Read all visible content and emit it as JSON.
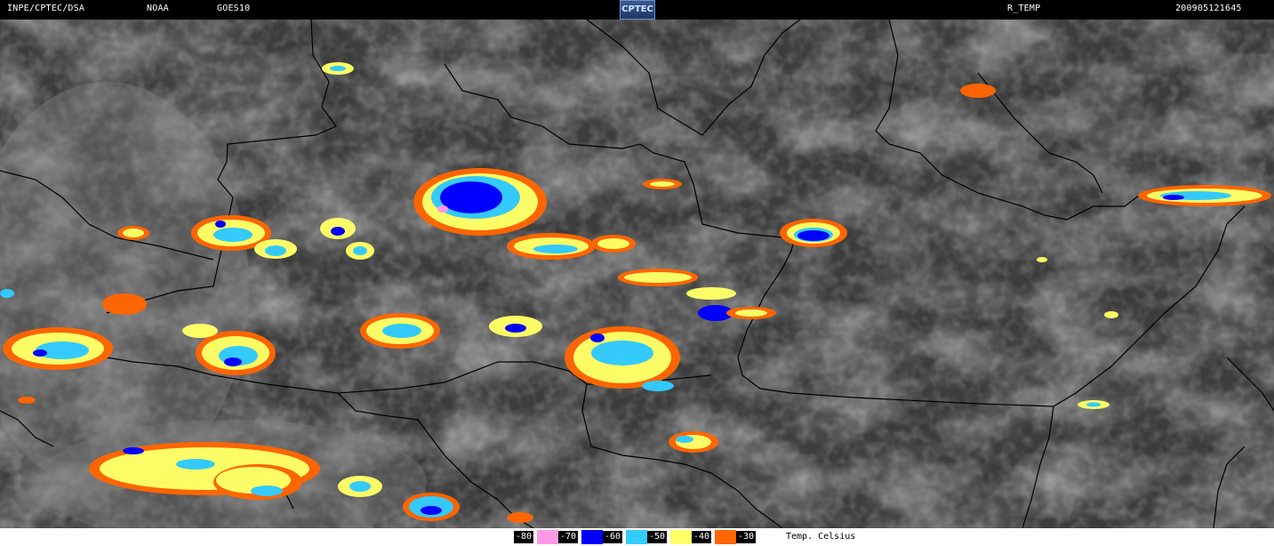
{
  "header": {
    "org": "INPE/CPTEC/DSA",
    "agency": "NOAA",
    "satellite": "GOES10",
    "logo": "CPTEC",
    "product": "R_TEMP",
    "timestamp": "200905121645"
  },
  "legend": {
    "unit": "Temp. Celsius",
    "items": [
      {
        "label": "-80",
        "color": "#ff99e6"
      },
      {
        "label": "-70",
        "color": "#0000ff"
      },
      {
        "label": "-60",
        "color": "#33ccff"
      },
      {
        "label": "-50",
        "color": "#ffff66"
      },
      {
        "label": "-40",
        "color": "#ff6600"
      },
      {
        "label": "-30",
        "color": "#ffffff"
      }
    ]
  },
  "colors": {
    "background": "#3a3a3a",
    "border": "#000000"
  }
}
